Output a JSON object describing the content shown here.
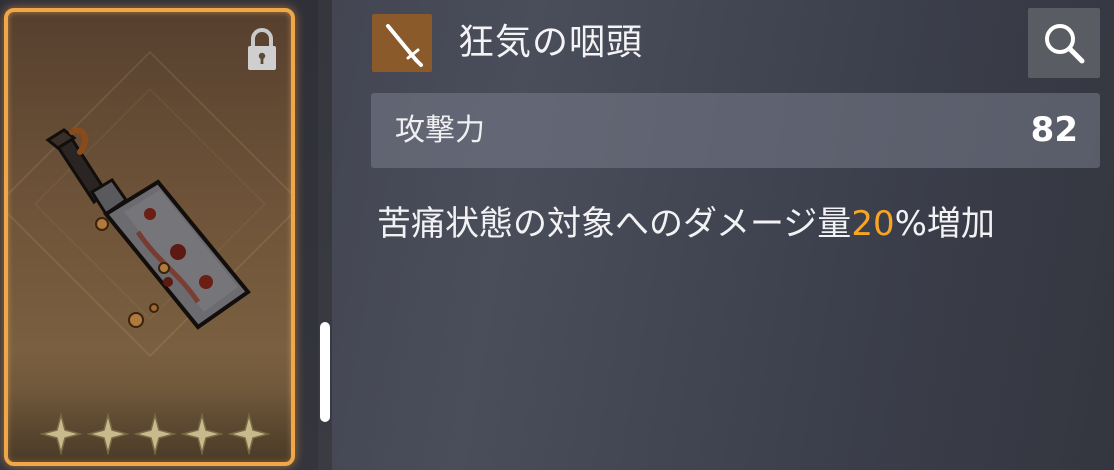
{
  "weapon": {
    "name": "狂気の咽頭",
    "type_icon": "sword-icon",
    "locked": true,
    "stars": 5,
    "rarity_color": "#f2a64a"
  },
  "stats": [
    {
      "label": "攻撃力",
      "value": "82"
    }
  ],
  "effect": {
    "before": "苦痛状態の対象へのダメージ量",
    "highlight": "20",
    "after": "%増加",
    "highlight_color": "#f6a623"
  },
  "icons": {
    "search": "search-icon",
    "lock": "lock-icon",
    "star": "star-icon"
  }
}
